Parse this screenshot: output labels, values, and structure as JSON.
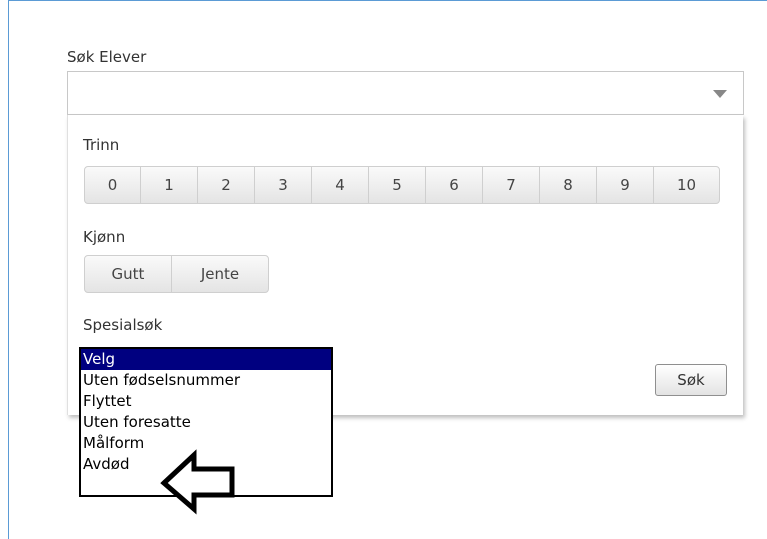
{
  "search": {
    "title": "Søk Elever"
  },
  "filters": {
    "trinn": {
      "label": "Trinn",
      "options": [
        "0",
        "1",
        "2",
        "3",
        "4",
        "5",
        "6",
        "7",
        "8",
        "9",
        "10"
      ]
    },
    "kjonn": {
      "label": "Kjønn",
      "options": [
        "Gutt",
        "Jente"
      ]
    },
    "spesial": {
      "label": "Spesialsøk",
      "options": [
        "Velg",
        "Uten fødselsnummer",
        "Flyttet",
        "Uten foresatte",
        "Målform",
        "Avdød"
      ],
      "selected": "Velg"
    },
    "submit_label": "Søk"
  },
  "icons": {
    "dropdown": "chevron-down-icon",
    "annotation": "arrow-left-icon"
  },
  "colors": {
    "frame_border": "#5b9bd5",
    "selected_option_bg": "#000080"
  }
}
